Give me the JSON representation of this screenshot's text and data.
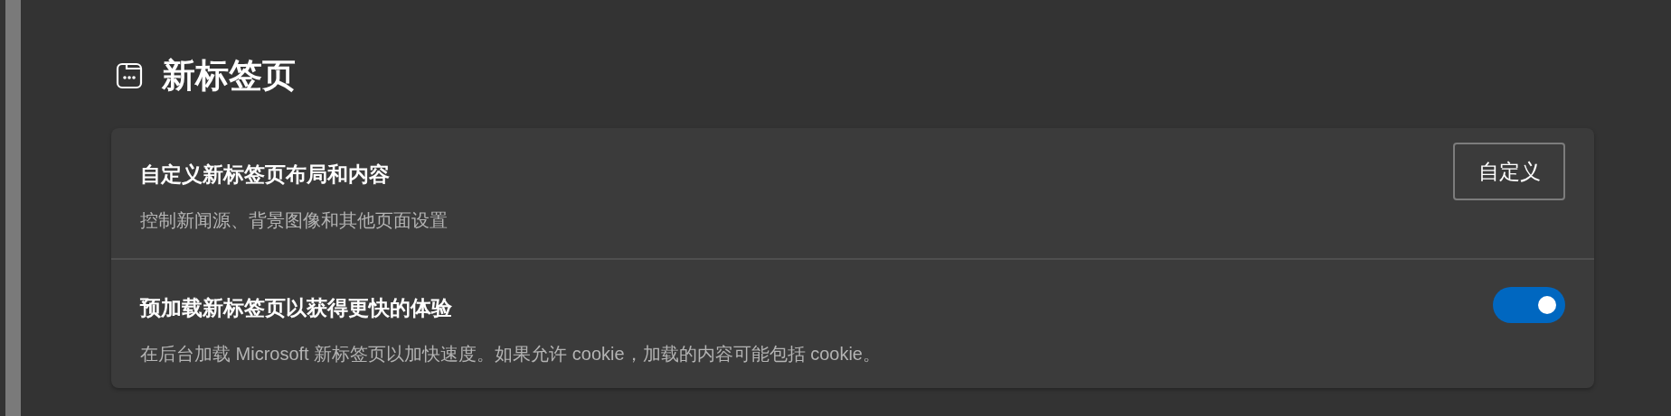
{
  "section": {
    "title": "新标签页"
  },
  "settings": [
    {
      "kind": "button",
      "title": "自定义新标签页布局和内容",
      "description": "控制新闻源、背景图像和其他页面设置",
      "button": "自定义"
    },
    {
      "kind": "toggle",
      "title": "预加载新标签页以获得更快的体验",
      "description": "在后台加载 Microsoft 新标签页以加快速度。如果允许 cookie，加载的内容可能包括 cookie。",
      "on": true
    }
  ]
}
